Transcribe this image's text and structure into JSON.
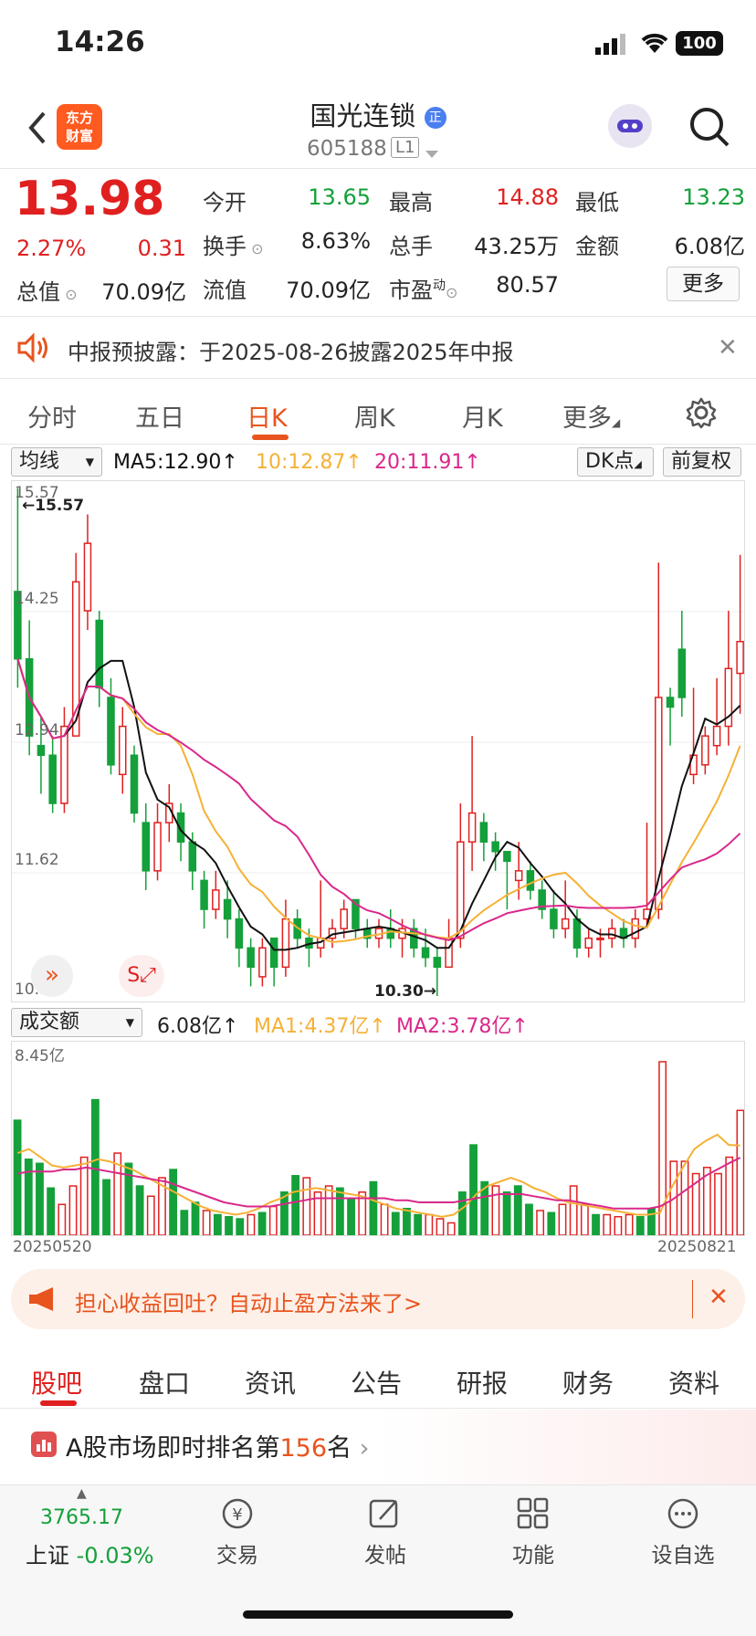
{
  "status": {
    "time": "14:26",
    "battery": "100"
  },
  "header": {
    "back_icon": "chevron-left-icon",
    "logo_line1": "东方",
    "logo_line2": "财富",
    "title": "国光连锁",
    "badge": "正",
    "code": "605188",
    "level": "L1"
  },
  "quote": {
    "price": "13.98",
    "change_pct": "2.27%",
    "change": "0.31",
    "open_label": "今开",
    "open": "13.65",
    "high_label": "最高",
    "high": "14.88",
    "low_label": "最低",
    "low": "13.23",
    "turnover_label": "换手",
    "turnover": "8.63%",
    "volume_label": "总手",
    "volume": "43.25万",
    "amount_label": "金额",
    "amount": "6.08亿",
    "mktcap_label": "总值",
    "mktcap": "70.09亿",
    "float_label": "流值",
    "float": "70.09亿",
    "pe_label": "市盈",
    "pe_sup": "动",
    "pe": "80.57",
    "more": "更多"
  },
  "notice": {
    "text": "中报预披露：于2025-08-26披露2025年中报"
  },
  "chart_tabs": [
    "分时",
    "五日",
    "日K",
    "周K",
    "月K",
    "更多"
  ],
  "ma_bar": {
    "selector": "均线",
    "ma5": "MA5:12.90↑",
    "ma10": "10:12.87↑",
    "ma20": "20:11.91↑",
    "dk": "DK点",
    "fq": "前复权"
  },
  "vol_bar": {
    "selector": "成交额",
    "val": "6.08亿↑",
    "ma1": "MA1:4.37亿↑",
    "ma2": "MA2:3.78亿↑"
  },
  "chart_data": {
    "type": "candlestick",
    "y_ticks": [
      "15.57",
      "14.25",
      "12.94",
      "11.62",
      "10.30"
    ],
    "high_marker": "←15.57",
    "low_marker": "10.30→",
    "vol_max_label": "8.45亿",
    "x_start": "20250520",
    "x_end": "20250821",
    "ylim": [
      10.3,
      15.57
    ],
    "colors": {
      "up": "#e02020",
      "down": "#14a03a",
      "ma5": "#111111",
      "ma10": "#f5b135",
      "ma20": "#d9288a"
    },
    "candles": [
      [
        14.5,
        13.8,
        15.57,
        13.5
      ],
      [
        13.8,
        13.0,
        14.2,
        12.8
      ],
      [
        12.9,
        12.8,
        13.2,
        12.4
      ],
      [
        12.8,
        12.3,
        13.0,
        12.2
      ],
      [
        12.3,
        13.1,
        13.3,
        12.2
      ],
      [
        13.0,
        14.6,
        14.9,
        13.0
      ],
      [
        14.3,
        15.0,
        15.3,
        14.1
      ],
      [
        14.2,
        13.5,
        14.3,
        13.3
      ],
      [
        13.4,
        12.7,
        13.6,
        12.6
      ],
      [
        12.6,
        13.1,
        13.3,
        12.4
      ],
      [
        12.8,
        12.2,
        12.9,
        12.1
      ],
      [
        12.1,
        11.6,
        12.3,
        11.4
      ],
      [
        11.6,
        12.1,
        12.3,
        11.5
      ],
      [
        12.1,
        12.3,
        12.5,
        11.9
      ],
      [
        12.2,
        11.9,
        12.3,
        11.7
      ],
      [
        11.9,
        11.6,
        12.0,
        11.4
      ],
      [
        11.5,
        11.2,
        11.6,
        11.0
      ],
      [
        11.2,
        11.4,
        11.6,
        11.1
      ],
      [
        11.3,
        11.1,
        11.5,
        10.9
      ],
      [
        11.1,
        10.8,
        11.2,
        10.6
      ],
      [
        10.8,
        10.6,
        10.9,
        10.4
      ],
      [
        10.5,
        10.8,
        10.9,
        10.4
      ],
      [
        10.9,
        10.6,
        10.9,
        10.4
      ],
      [
        10.6,
        11.1,
        11.3,
        10.5
      ],
      [
        11.1,
        10.9,
        11.2,
        10.8
      ],
      [
        10.9,
        10.8,
        11.0,
        10.6
      ],
      [
        10.8,
        10.9,
        11.5,
        10.7
      ],
      [
        10.9,
        11.0,
        11.1,
        10.8
      ],
      [
        11.0,
        11.2,
        11.3,
        10.9
      ],
      [
        11.3,
        11.0,
        11.3,
        10.9
      ],
      [
        11.0,
        10.9,
        11.1,
        10.8
      ],
      [
        10.9,
        11.0,
        11.1,
        10.8
      ],
      [
        11.0,
        10.9,
        11.2,
        10.8
      ],
      [
        10.9,
        11.0,
        11.1,
        10.7
      ],
      [
        11.0,
        10.8,
        11.1,
        10.7
      ],
      [
        10.8,
        10.7,
        11.0,
        10.6
      ],
      [
        10.7,
        10.6,
        10.8,
        10.3
      ],
      [
        10.6,
        10.9,
        11.1,
        10.6
      ],
      [
        10.9,
        11.9,
        12.3,
        10.8
      ],
      [
        11.9,
        12.2,
        13.0,
        11.6
      ],
      [
        12.1,
        11.9,
        12.2,
        11.7
      ],
      [
        11.9,
        11.8,
        12.0,
        11.6
      ],
      [
        11.8,
        11.7,
        11.8,
        11.2
      ],
      [
        11.5,
        11.6,
        11.9,
        11.3
      ],
      [
        11.6,
        11.4,
        11.7,
        11.3
      ],
      [
        11.4,
        11.2,
        11.5,
        11.1
      ],
      [
        11.2,
        11.0,
        11.4,
        10.9
      ],
      [
        11.0,
        11.1,
        11.5,
        10.9
      ],
      [
        11.1,
        10.8,
        11.2,
        10.7
      ],
      [
        10.8,
        10.9,
        11.0,
        10.7
      ],
      [
        10.9,
        10.9,
        11.0,
        10.7
      ],
      [
        10.9,
        11.0,
        11.1,
        10.8
      ],
      [
        11.0,
        10.9,
        11.1,
        10.8
      ],
      [
        10.9,
        11.1,
        11.2,
        10.8
      ],
      [
        11.1,
        11.2,
        12.1,
        11.0
      ],
      [
        11.2,
        13.4,
        14.8,
        11.1
      ],
      [
        13.4,
        13.3,
        13.5,
        12.9
      ],
      [
        13.9,
        13.4,
        14.3,
        13.2
      ],
      [
        12.6,
        12.8,
        13.5,
        12.5
      ],
      [
        12.7,
        13.0,
        13.1,
        12.6
      ],
      [
        12.9,
        13.1,
        13.6,
        12.8
      ],
      [
        13.1,
        13.7,
        14.3,
        12.9
      ],
      [
        13.65,
        13.98,
        14.88,
        13.23
      ]
    ],
    "volume": [
      5.6,
      3.7,
      3.5,
      2.3,
      1.5,
      2.4,
      3.8,
      6.6,
      2.7,
      4.0,
      3.5,
      2.4,
      1.9,
      2.8,
      3.2,
      1.2,
      1.6,
      1.2,
      1.0,
      0.9,
      0.8,
      1.0,
      1.1,
      1.4,
      2.1,
      2.9,
      2.8,
      2.1,
      2.4,
      2.3,
      1.8,
      2.1,
      2.6,
      1.5,
      1.1,
      1.3,
      1.0,
      1.0,
      0.8,
      0.6,
      2.1,
      4.4,
      2.6,
      2.4,
      2.1,
      2.4,
      1.5,
      1.2,
      1.1,
      1.5,
      2.4,
      1.5,
      1.0,
      1.0,
      0.9,
      1.0,
      0.9,
      1.3,
      8.45,
      3.6,
      3.6,
      3.0,
      3.3,
      3.0,
      3.8,
      6.08
    ],
    "vol_ma1": [
      4.0,
      4.2,
      3.8,
      3.4,
      3.3,
      3.4,
      3.5,
      3.7,
      3.6,
      3.4,
      3.2,
      2.9,
      2.6,
      2.3,
      2.0,
      1.7,
      1.4,
      1.2,
      1.1,
      1.0,
      1.1,
      1.3,
      1.6,
      1.8,
      2.1,
      2.2,
      2.3,
      2.2,
      2.1,
      2.0,
      1.9,
      1.7,
      1.5,
      1.3,
      1.2,
      1.1,
      1.0,
      0.9,
      1.0,
      1.4,
      2.0,
      2.4,
      2.6,
      2.8,
      2.6,
      2.3,
      2.1,
      1.8,
      1.6,
      1.5,
      1.4,
      1.3,
      1.2,
      1.1,
      1.0,
      1.0,
      1.1,
      2.3,
      3.3,
      4.2,
      4.6,
      4.9,
      4.4,
      4.37
    ],
    "vol_ma2": [
      3.0,
      3.1,
      3.1,
      3.1,
      3.2,
      3.2,
      3.3,
      3.2,
      3.1,
      3.0,
      2.9,
      2.8,
      2.7,
      2.6,
      2.4,
      2.2,
      2.0,
      1.8,
      1.6,
      1.5,
      1.4,
      1.4,
      1.4,
      1.5,
      1.6,
      1.7,
      1.8,
      1.8,
      1.8,
      1.8,
      1.8,
      1.8,
      1.8,
      1.7,
      1.7,
      1.6,
      1.6,
      1.6,
      1.6,
      1.7,
      1.8,
      1.9,
      2.0,
      2.0,
      2.0,
      1.9,
      1.8,
      1.7,
      1.7,
      1.6,
      1.5,
      1.4,
      1.3,
      1.3,
      1.3,
      1.3,
      1.4,
      1.7,
      2.1,
      2.5,
      2.9,
      3.2,
      3.5,
      3.78
    ]
  },
  "footer_nav": {
    "index_value": "3765.17",
    "index_name": "上证",
    "index_change": "-0.03%",
    "trade": "交易",
    "post": "发帖",
    "func": "功能",
    "watch": "设自选"
  },
  "promo": {
    "text": "担心收益回吐？自动止盈方法来了>"
  },
  "bottom_tabs": [
    "股吧",
    "盘口",
    "资讯",
    "公告",
    "研报",
    "财务",
    "资料"
  ],
  "rank": {
    "prefix": "A股市场即时排名第",
    "num": "156",
    "suffix": "名"
  }
}
